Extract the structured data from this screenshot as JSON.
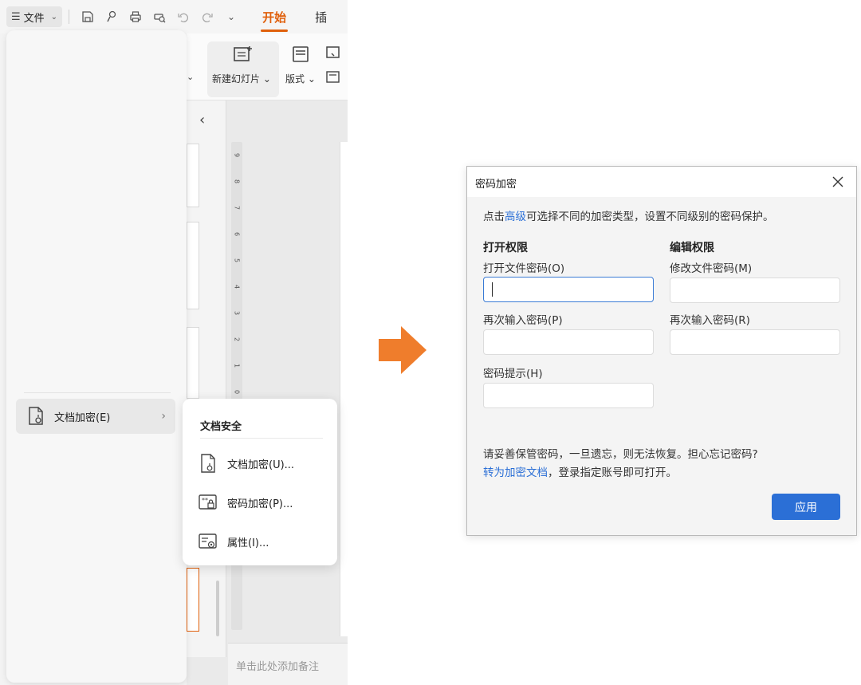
{
  "toolbar": {
    "file_label": "文件",
    "tab_start": "开始",
    "tab_insert": "插"
  },
  "ribbon": {
    "new_slide_label": "新建幻灯片",
    "layout_label": "版式"
  },
  "ruler_numbers": [
    "9",
    "8",
    "7",
    "6",
    "5",
    "4",
    "3",
    "2",
    "1",
    "0"
  ],
  "notes_placeholder": "单击此处添加备注",
  "file_menu": {
    "item_label": "文档加密(E)"
  },
  "submenu": {
    "title": "文档安全",
    "items": [
      {
        "label": "文档加密(U)...",
        "icon": "document-lock-icon"
      },
      {
        "label": "密码加密(P)...",
        "icon": "password-lock-icon"
      },
      {
        "label": "属性(I)...",
        "icon": "properties-gear-icon"
      }
    ]
  },
  "dialog": {
    "title": "密码加密",
    "desc_prefix": "点击",
    "desc_link": "高级",
    "desc_suffix": "可选择不同的加密类型，设置不同级别的密码保护。",
    "open_section": "打开权限",
    "edit_section": "编辑权限",
    "open_pwd_label": "打开文件密码(O)",
    "open_pwd_value": "",
    "open_confirm_label": "再次输入密码(P)",
    "open_confirm_value": "",
    "hint_label": "密码提示(H)",
    "hint_value": "",
    "edit_pwd_label": "修改文件密码(M)",
    "edit_pwd_value": "",
    "edit_confirm_label": "再次输入密码(R)",
    "edit_confirm_value": "",
    "warning_line1": "请妥善保管密码，一旦遗忘，则无法恢复。担心忘记密码?",
    "warning_link": "转为加密文档",
    "warning_line2_suffix": "，登录指定账号即可打开。",
    "apply_label": "应用"
  },
  "colors": {
    "accent_orange": "#e0600c",
    "arrow_orange": "#ef7d2c",
    "link_blue": "#2b6fd6",
    "button_blue": "#2b6fd6"
  }
}
